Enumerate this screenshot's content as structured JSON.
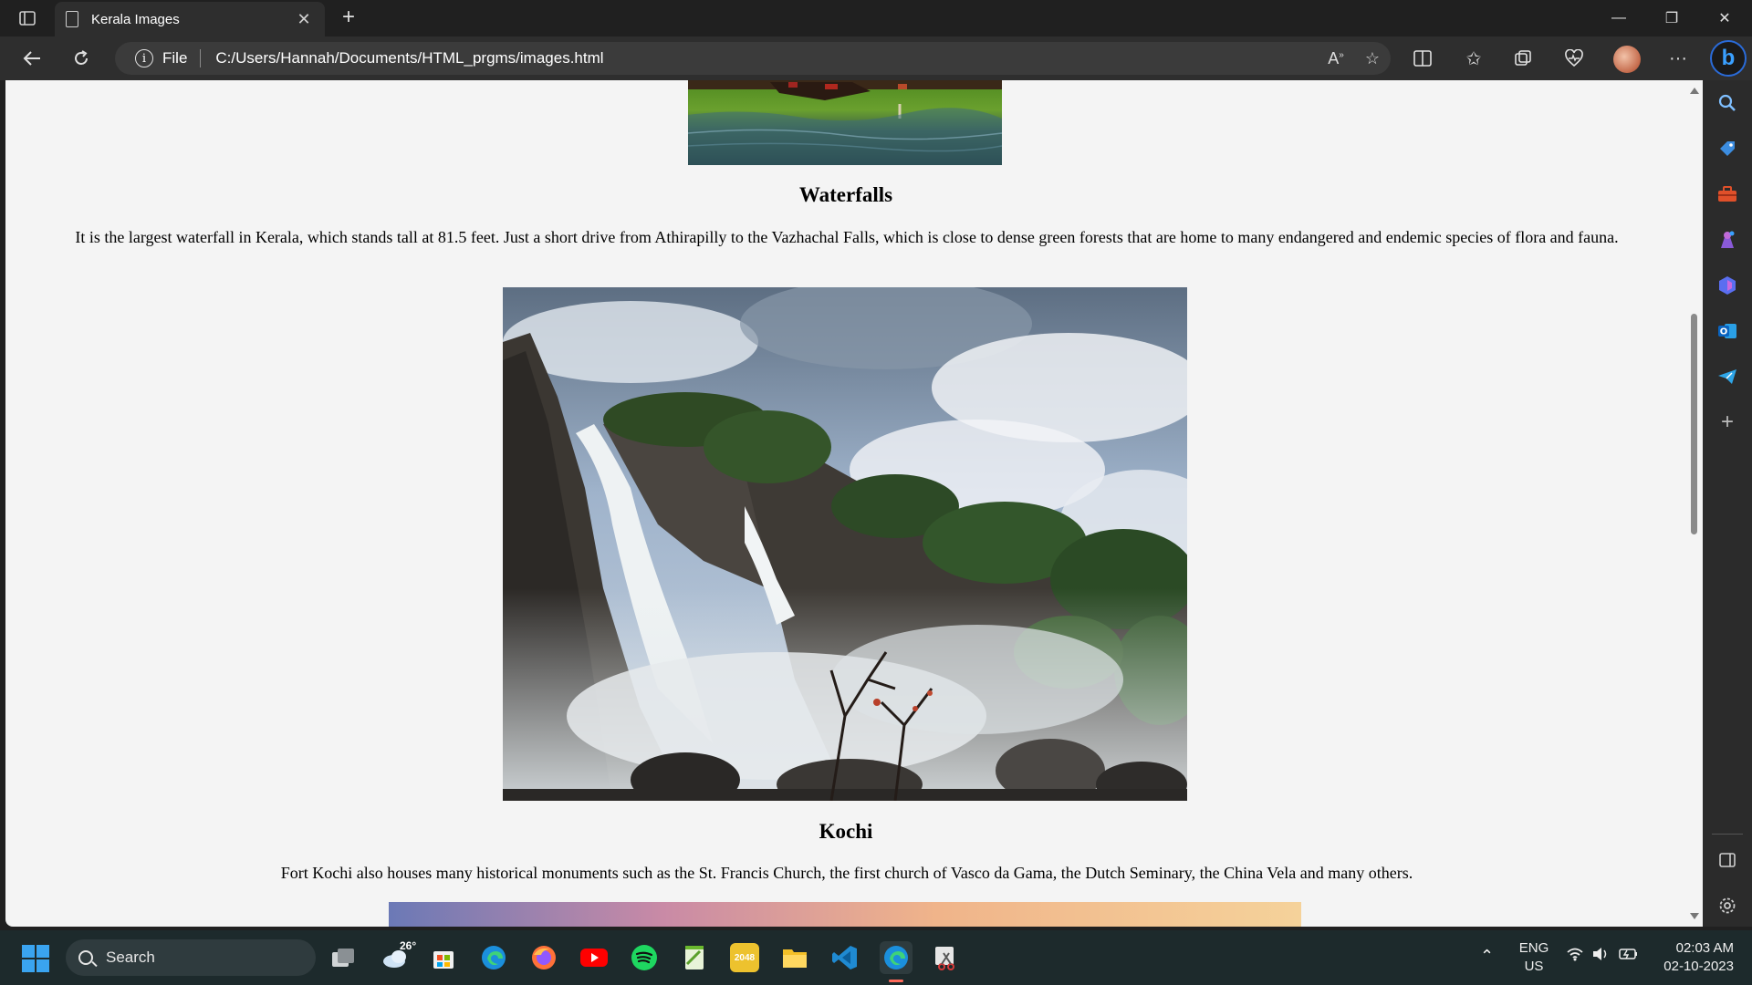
{
  "browser": {
    "tab_title": "Kerala Images",
    "tab_close": "✕",
    "new_tab": "+",
    "window_controls": {
      "minimize": "—",
      "restore": "❐",
      "close": "✕"
    },
    "address": {
      "scheme": "File",
      "url": "C:/Users/Hannah/Documents/HTML_prgms/images.html"
    },
    "toolbar_icons": [
      "back-icon",
      "refresh-icon",
      "read-aloud-icon",
      "favorite-star-icon",
      "split-screen-icon",
      "favorites-icon",
      "collections-icon",
      "browser-essentials-icon",
      "profile-avatar",
      "more-icon",
      "bing-copilot-icon"
    ]
  },
  "page": {
    "sections": [
      {
        "heading": "Waterfalls",
        "text": "It is the largest waterfall in Kerala, which stands tall at 81.5 feet. Just a short drive from Athirapilly to the Vazhachal Falls, which is close to dense green forests that are home to many endangered and endemic species of flora and fauna."
      },
      {
        "heading": "Kochi",
        "text": "Fort Kochi also houses many historical monuments such as the St. Francis Church, the first church of Vasco da Gama, the Dutch Seminary, the China Vela and many others."
      }
    ]
  },
  "sidebar_icons": [
    "search-icon",
    "shopping-tag-icon",
    "tools-icon",
    "games-icon",
    "copilot-icon",
    "outlook-icon",
    "telegram-icon",
    "add-icon",
    "hide-sidebar-icon",
    "settings-icon"
  ],
  "taskbar": {
    "search_placeholder": "Search",
    "weather_temp": "26°",
    "game_label": "2048",
    "apps": [
      "task-view-icon",
      "weather-icon",
      "store-icon",
      "edge-icon",
      "firefox-icon",
      "youtube-icon",
      "spotify-icon",
      "notepad-icon",
      "2048-icon",
      "file-explorer-icon",
      "vscode-icon",
      "edge-active-icon",
      "snipping-tool-icon"
    ],
    "tray": {
      "lang_line1": "ENG",
      "lang_line2": "US",
      "time": "02:03 AM",
      "date": "02-10-2023"
    }
  }
}
